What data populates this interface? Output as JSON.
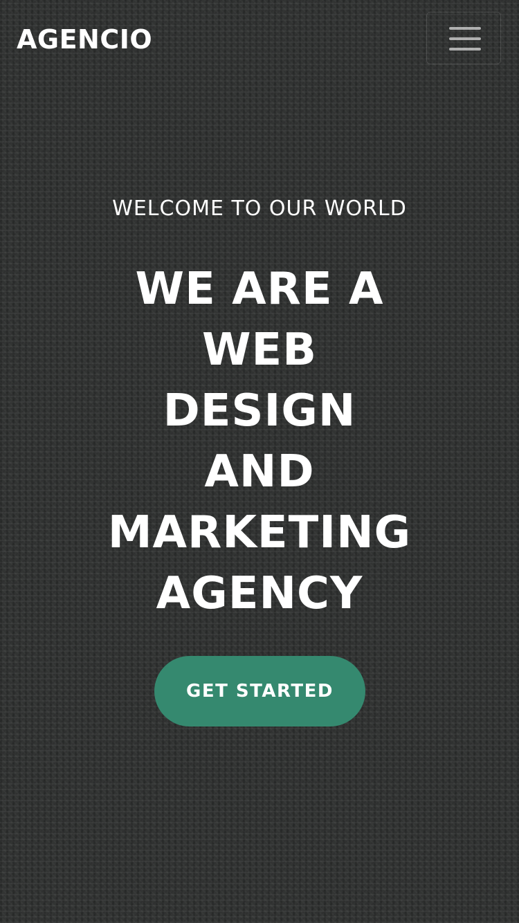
{
  "brand": {
    "name": "AGENCIO"
  },
  "nav": {
    "menu_icon": "hamburger-menu-icon"
  },
  "hero": {
    "eyebrow": "WELCOME TO OUR WORLD",
    "title_lines": [
      "WE ARE A",
      "WEB",
      "DESIGN",
      "AND",
      "MARKETING",
      "AGENCY"
    ],
    "cta_label": "GET STARTED"
  },
  "colors": {
    "accent": "#35896f",
    "background": "#3b3c3b",
    "text": "#ffffff"
  }
}
